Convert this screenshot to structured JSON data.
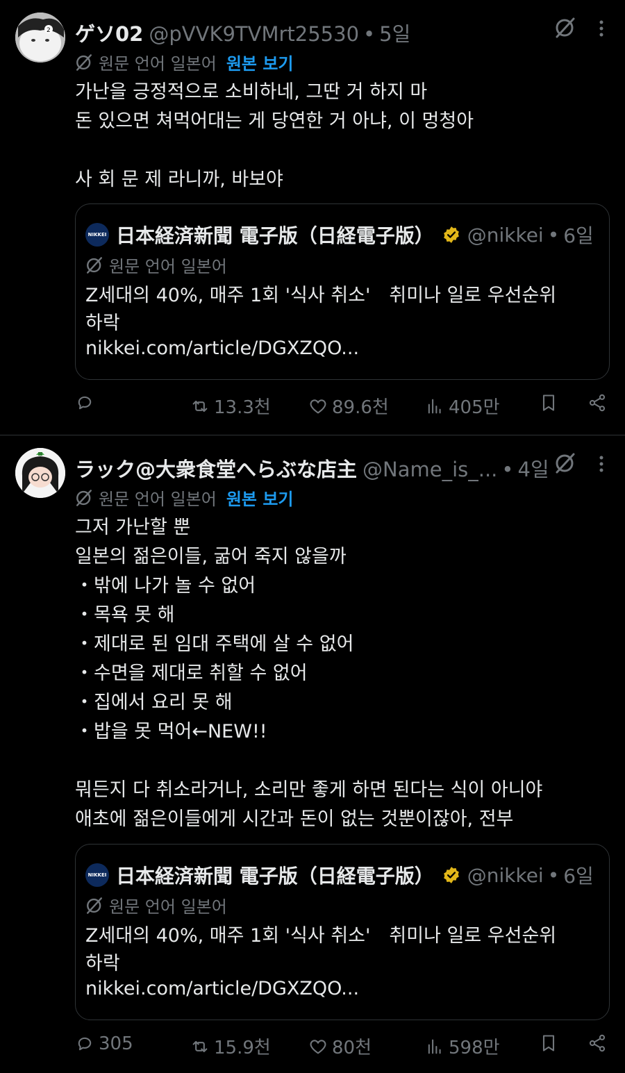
{
  "colors": {
    "background": "#000000",
    "text": "#e7e9ea",
    "muted": "#71767b",
    "link": "#1d9bf0",
    "verified": "#e2b719"
  },
  "posts": [
    {
      "author_name": "ゲソ02",
      "handle": "@pVVK9TVMrt25530",
      "separator": "•",
      "time": "5일",
      "translation_label": "원문 언어 일본어",
      "view_original": "원본 보기",
      "text": "가난을 긍정적으로 소비하네, 그딴 거 하지 마\n돈 있으면 쳐먹어대는 게 당연한 거 아냐, 이 멍청아\n\n사 회 문 제 라니까, 바보야",
      "quote": {
        "avatar_text": "NIKKEI",
        "name": "日本経済新聞 電子版（日経電子版）",
        "handle": "@nikkei",
        "separator": "•",
        "time": "6일",
        "translation_label": "원문 언어 일본어",
        "text": "Z세대의 40%, 매주 1회 '식사 취소'　취미나 일로 우선순위\n하락",
        "link": "nikkei.com/article/DGXZQO..."
      },
      "actions": {
        "replies": "",
        "reposts": "13.3천",
        "likes": "89.6천",
        "views": "405만"
      }
    },
    {
      "author_name": "ラック@大衆食堂へらぶな店主",
      "handle": "@Name_is_...",
      "separator": "•",
      "time": "4일",
      "translation_label": "원문 언어 일본어",
      "view_original": "원본 보기",
      "text": "그저 가난할 뿐\n일본의 젊은이들, 굶어 죽지 않을까\n ・밖에 나가 놀 수 없어\n ・목욕 못 해\n ・제대로 된 임대 주택에 살 수 없어\n ・수면을 제대로 취할 수 없어\n ・집에서 요리 못 해\n ・밥을 못 먹어←NEW!!\n\n뭐든지 다 취소라거나, 소리만 좋게 하면 된다는 식이 아니야\n애초에 젊은이들에게 시간과 돈이 없는 것뿐이잖아, 전부",
      "quote": {
        "avatar_text": "NIKKEI",
        "name": "日本経済新聞 電子版（日経電子版）",
        "handle": "@nikkei",
        "separator": "•",
        "time": "6일",
        "translation_label": "원문 언어 일본어",
        "text": "Z세대의 40%, 매주 1회 '식사 취소'　취미나 일로 우선순위\n하락",
        "link": "nikkei.com/article/DGXZQO..."
      },
      "actions": {
        "replies": "305",
        "reposts": "15.9천",
        "likes": "80천",
        "views": "598만"
      }
    }
  ]
}
